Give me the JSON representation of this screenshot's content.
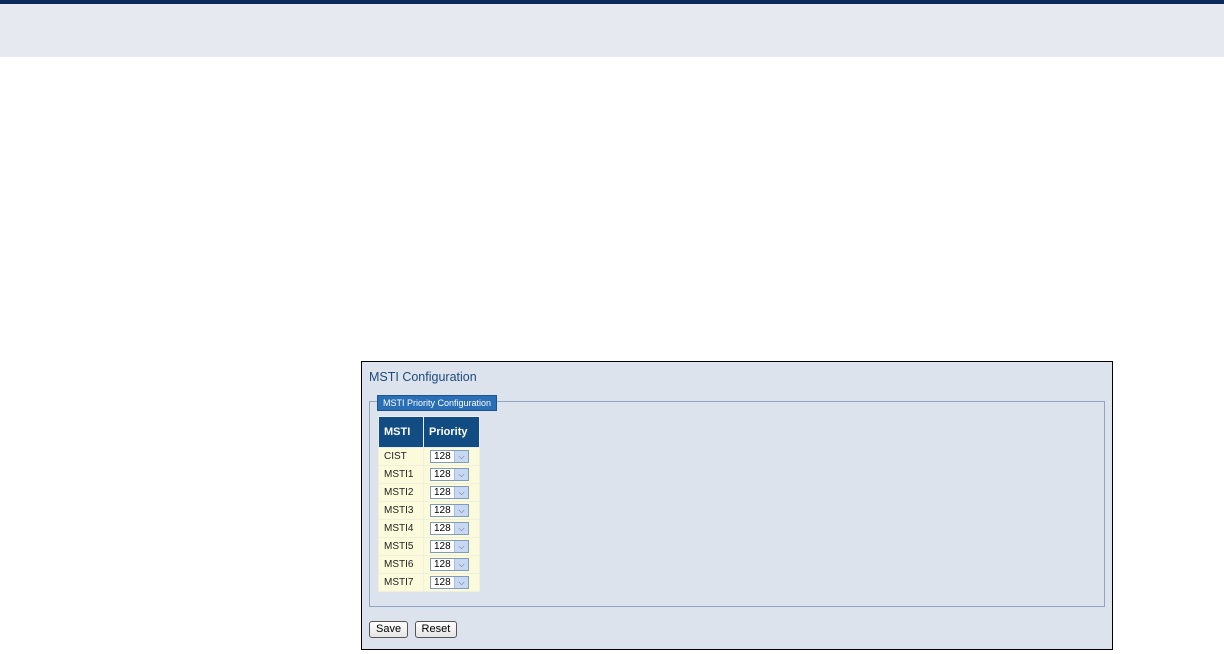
{
  "page": {
    "title": "MSTI Configuration"
  },
  "section": {
    "legend": "MSTI Priority Configuration"
  },
  "table": {
    "headers": {
      "msti": "MSTI",
      "priority": "Priority"
    },
    "rows": [
      {
        "msti": "CIST",
        "priority": "128"
      },
      {
        "msti": "MSTI1",
        "priority": "128"
      },
      {
        "msti": "MSTI2",
        "priority": "128"
      },
      {
        "msti": "MSTI3",
        "priority": "128"
      },
      {
        "msti": "MSTI4",
        "priority": "128"
      },
      {
        "msti": "MSTI5",
        "priority": "128"
      },
      {
        "msti": "MSTI6",
        "priority": "128"
      },
      {
        "msti": "MSTI7",
        "priority": "128"
      }
    ]
  },
  "buttons": {
    "save": "Save",
    "reset": "Reset"
  },
  "icons": {
    "dropdown": "chevron-down-icon"
  },
  "colors": {
    "header_bg": "#114c82",
    "legend_bg": "#2a6fb5",
    "row_bg": "#fbfbdc",
    "panel_bg": "#dce3ec"
  }
}
